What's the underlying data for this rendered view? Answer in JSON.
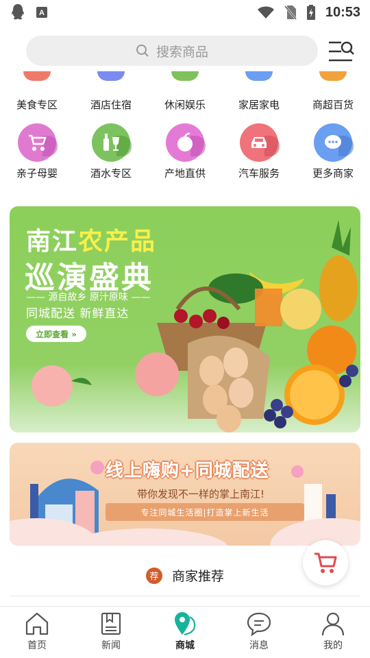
{
  "status_bar": {
    "time": "10:53",
    "icons": [
      "qq-icon",
      "a-icon",
      "wifi-icon",
      "no-sim-icon",
      "battery-charging-icon"
    ]
  },
  "search": {
    "placeholder": "搜索商品",
    "icon": "search-icon"
  },
  "header": {
    "menu_icon": "menu-search-icon"
  },
  "categories_row1": [
    {
      "label": "美食专区",
      "color": "#f07a6a"
    },
    {
      "label": "酒店住宿",
      "color": "#7b8cf0"
    },
    {
      "label": "休闲娱乐",
      "color": "#7fc25d"
    },
    {
      "label": "家居家电",
      "color": "#6a9ef0"
    },
    {
      "label": "商超百货",
      "color": "#f0a33a"
    }
  ],
  "categories_row2": [
    {
      "label": "亲子母婴",
      "icon": "stroller-icon",
      "color": "#e07ad0"
    },
    {
      "label": "酒水专区",
      "icon": "wine-icon",
      "color": "#7cc35f"
    },
    {
      "label": "产地直供",
      "icon": "apple-icon",
      "color": "#e47ad6"
    },
    {
      "label": "汽车服务",
      "icon": "car-icon",
      "color": "#f0727a"
    },
    {
      "label": "更多商家",
      "icon": "more-chat-icon",
      "color": "#6a9ef0"
    }
  ],
  "banner1": {
    "title_part1": "南江",
    "title_part2": "农产品",
    "title_line2": "巡演盛典",
    "tagline": "—— 源自故乡 原汁原味 ——",
    "tagline2": "同城配送  新鲜直达",
    "button": "立即查看 »"
  },
  "banner2": {
    "title": "线上嗨购+同城配送",
    "subtitle": "带你发现不一样的掌上南江!",
    "strip": "专注同城生活圈|打造掌上新生活"
  },
  "section": {
    "badge": "荐",
    "title": "商家推荐"
  },
  "cart_icon": "cart-icon",
  "bottom_nav": [
    {
      "label": "首页",
      "icon": "home-icon",
      "active": false
    },
    {
      "label": "新闻",
      "icon": "news-icon",
      "active": false
    },
    {
      "label": "商城",
      "icon": "mall-location-icon",
      "active": true
    },
    {
      "label": "消息",
      "icon": "message-icon",
      "active": false
    },
    {
      "label": "我的",
      "icon": "profile-icon",
      "active": false
    }
  ],
  "colors": {
    "accent": "#17b39b",
    "cart": "#e5484d"
  }
}
